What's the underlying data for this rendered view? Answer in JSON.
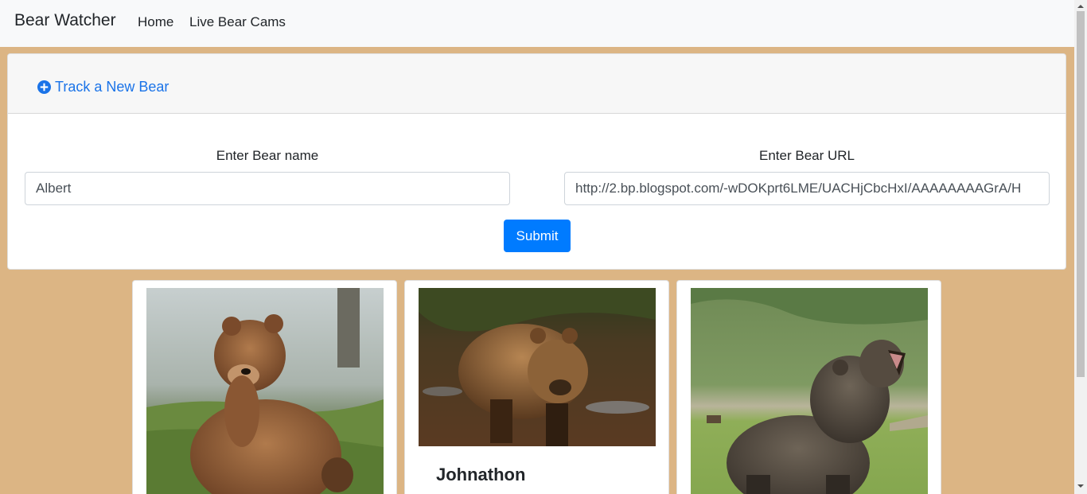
{
  "navbar": {
    "brand": "Bear Watcher",
    "links": [
      "Home",
      "Live Bear Cams"
    ]
  },
  "form": {
    "header_link": "Track a New Bear",
    "header_icon": "plus-circle-icon",
    "name_label": "Enter Bear name",
    "name_value": "Albert",
    "url_label": "Enter Bear URL",
    "url_value": "http://2.bp.blogspot.com/-wDOKprt6LME/UACHjCbcHxI/AAAAAAAAGrA/H",
    "submit_label": "Submit"
  },
  "bears": [
    {
      "name": "",
      "photo": "brown bear sitting on grass in fog"
    },
    {
      "name": "Johnathon",
      "photo": "brown bear walking in forest"
    },
    {
      "name": "",
      "photo": "grizzly bear roaring in meadow"
    }
  ],
  "colors": {
    "page_background": "#dcb584",
    "link_blue": "#1a73e8",
    "button_blue": "#007bff",
    "navbar_background": "#f8f9fa"
  }
}
